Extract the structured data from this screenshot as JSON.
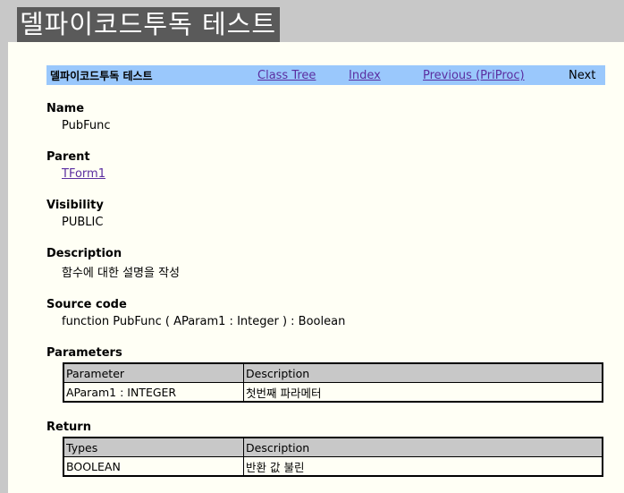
{
  "window": {
    "title": "델파이코드투독 테스트"
  },
  "nav": {
    "brand": "델파이코드투독 테스트",
    "class_tree": "Class Tree",
    "index": "Index",
    "previous": "Previous (PriProc)",
    "next": "Next"
  },
  "name": {
    "heading": "Name",
    "value": "PubFunc"
  },
  "parent": {
    "heading": "Parent",
    "value": "TForm1"
  },
  "visibility": {
    "heading": "Visibility",
    "value": "PUBLIC"
  },
  "description": {
    "heading": "Description",
    "value": "함수에 대한 설명을 작성"
  },
  "source": {
    "heading": "Source code",
    "value": "function PubFunc ( AParam1 : Integer ) : Boolean"
  },
  "parameters": {
    "heading": "Parameters",
    "columns": [
      "Parameter",
      "Description"
    ],
    "rows": [
      [
        "AParam1 : INTEGER",
        "첫번째 파라메터"
      ]
    ]
  },
  "return": {
    "heading": "Return",
    "columns": [
      "Types",
      "Description"
    ],
    "rows": [
      [
        "BOOLEAN",
        "반환 값 불린"
      ]
    ]
  }
}
